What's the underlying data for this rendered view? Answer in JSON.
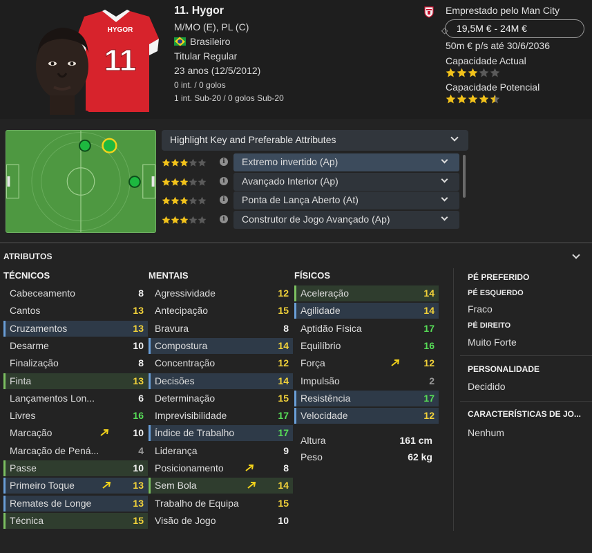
{
  "player": {
    "name": "11. Hygor",
    "positions": "M/MO (E), PL (C)",
    "nationality": "Brasileiro",
    "status": "Titular Regular",
    "age": "23 anos (12/5/2012)",
    "caps": "0 int. / 0 golos",
    "u20_caps": "1 int. Sub-20 / 0 golos Sub-20",
    "shirt_name": "HYGOR",
    "shirt_number": "11"
  },
  "contract": {
    "loan": "Emprestado pelo Man City",
    "value": "19,5M € - 24M €",
    "wage": "50m € p/s até 30/6/2036",
    "current_ability_label": "Capacidade Actual",
    "current_ability_stars": 3,
    "potential_ability_label": "Capacidade Potencial",
    "potential_ability_stars": 4.5
  },
  "roles": {
    "highlight_label": "Highlight Key and Preferable Attributes",
    "items": [
      {
        "name": "Extremo invertido (Ap)",
        "stars": 3
      },
      {
        "name": "Avançado Interior (Ap)",
        "stars": 3
      },
      {
        "name": "Ponta de Lança Aberto (At)",
        "stars": 3
      },
      {
        "name": "Construtor de Jogo Avançado (Ap)",
        "stars": 3
      }
    ]
  },
  "attributes": {
    "title": "ATRIBUTOS",
    "technical_title": "TÉCNICOS",
    "mental_title": "MENTAIS",
    "physical_title": "FÍSICOS",
    "technical": [
      {
        "name": "Cabeceamento",
        "value": "8",
        "hl": "",
        "arrow": false
      },
      {
        "name": "Cantos",
        "value": "13",
        "hl": "",
        "arrow": false
      },
      {
        "name": "Cruzamentos",
        "value": "13",
        "hl": "blue",
        "arrow": false
      },
      {
        "name": "Desarme",
        "value": "10",
        "hl": "",
        "arrow": false
      },
      {
        "name": "Finalização",
        "value": "8",
        "hl": "",
        "arrow": false
      },
      {
        "name": "Finta",
        "value": "13",
        "hl": "green",
        "arrow": false
      },
      {
        "name": "Lançamentos Lon...",
        "value": "6",
        "hl": "",
        "arrow": false
      },
      {
        "name": "Livres",
        "value": "16",
        "hl": "",
        "arrow": false
      },
      {
        "name": "Marcação",
        "value": "10",
        "hl": "",
        "arrow": true
      },
      {
        "name": "Marcação de Pená...",
        "value": "4",
        "hl": "",
        "arrow": false
      },
      {
        "name": "Passe",
        "value": "10",
        "hl": "green",
        "arrow": false
      },
      {
        "name": "Primeiro Toque",
        "value": "13",
        "hl": "blue",
        "arrow": true
      },
      {
        "name": "Remates de Longe",
        "value": "13",
        "hl": "blue",
        "arrow": false
      },
      {
        "name": "Técnica",
        "value": "15",
        "hl": "green",
        "arrow": false
      }
    ],
    "mental": [
      {
        "name": "Agressividade",
        "value": "12",
        "hl": "",
        "arrow": false
      },
      {
        "name": "Antecipação",
        "value": "15",
        "hl": "",
        "arrow": false
      },
      {
        "name": "Bravura",
        "value": "8",
        "hl": "",
        "arrow": false
      },
      {
        "name": "Compostura",
        "value": "14",
        "hl": "blue",
        "arrow": false
      },
      {
        "name": "Concentração",
        "value": "12",
        "hl": "",
        "arrow": false
      },
      {
        "name": "Decisões",
        "value": "14",
        "hl": "blue",
        "arrow": false
      },
      {
        "name": "Determinação",
        "value": "15",
        "hl": "",
        "arrow": false
      },
      {
        "name": "Imprevisibilidade",
        "value": "17",
        "hl": "",
        "arrow": false
      },
      {
        "name": "Índice de Trabalho",
        "value": "17",
        "hl": "blue",
        "arrow": false
      },
      {
        "name": "Liderança",
        "value": "9",
        "hl": "",
        "arrow": false
      },
      {
        "name": "Posicionamento",
        "value": "8",
        "hl": "",
        "arrow": true
      },
      {
        "name": "Sem Bola",
        "value": "14",
        "hl": "green",
        "arrow": true
      },
      {
        "name": "Trabalho de Equipa",
        "value": "15",
        "hl": "",
        "arrow": false
      },
      {
        "name": "Visão de Jogo",
        "value": "10",
        "hl": "",
        "arrow": false
      }
    ],
    "physical": [
      {
        "name": "Aceleração",
        "value": "14",
        "hl": "green",
        "arrow": false
      },
      {
        "name": "Agilidade",
        "value": "14",
        "hl": "blue",
        "arrow": false
      },
      {
        "name": "Aptidão Física",
        "value": "17",
        "hl": "",
        "arrow": false
      },
      {
        "name": "Equilíbrio",
        "value": "16",
        "hl": "",
        "arrow": false
      },
      {
        "name": "Força",
        "value": "12",
        "hl": "",
        "arrow": true
      },
      {
        "name": "Impulsão",
        "value": "2",
        "hl": "",
        "arrow": false
      },
      {
        "name": "Resistência",
        "value": "17",
        "hl": "blue",
        "arrow": false
      },
      {
        "name": "Velocidade",
        "value": "12",
        "hl": "blue",
        "arrow": false
      }
    ],
    "height_label": "Altura",
    "height_value": "161 cm",
    "weight_label": "Peso",
    "weight_value": "62 kg"
  },
  "side": {
    "foot_title": "PÉ PREFERIDO",
    "left_label": "PÉ ESQUERDO",
    "left_value": "Fraco",
    "right_label": "PÉ DIREITO",
    "right_value": "Muito Forte",
    "personality_title": "PERSONALIDADE",
    "personality_value": "Decidido",
    "traits_title": "CARACTERÍSTICAS DE JO...",
    "traits_value": "Nenhum"
  },
  "colors": {
    "background": "#232323",
    "value_white": "#f2f2f2",
    "value_yellow": "#f2d23a",
    "value_green": "#57dd57",
    "value_grey": "#9a9a9a",
    "highlight_blue": "#6a9fd8",
    "highlight_green": "#7cc061",
    "star_gold": "#f2c21b",
    "pitch_green": "#4e9841"
  }
}
